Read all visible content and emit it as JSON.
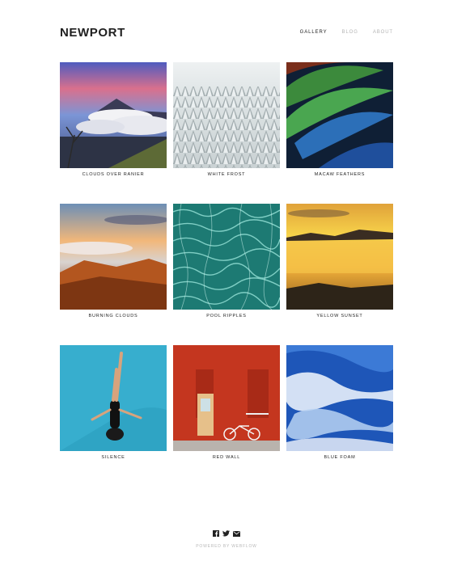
{
  "header": {
    "logo": "NEWPORT",
    "nav": [
      {
        "label": "GALLERY",
        "active": true
      },
      {
        "label": "BLOG",
        "active": false
      },
      {
        "label": "ABOUT",
        "active": false
      }
    ]
  },
  "gallery": [
    {
      "caption": "CLOUDS OVER RANIER"
    },
    {
      "caption": "WHITE FROST"
    },
    {
      "caption": "MACAW FEATHERS"
    },
    {
      "caption": "BURNING CLOUDS"
    },
    {
      "caption": "POOL RIPPLES"
    },
    {
      "caption": "YELLOW SUNSET"
    },
    {
      "caption": "SILENCE"
    },
    {
      "caption": "RED WALL"
    },
    {
      "caption": "BLUE FOAM"
    }
  ],
  "footer": {
    "icons": [
      "facebook-icon",
      "twitter-icon",
      "email-icon"
    ],
    "powered_by": "POWERED BY WEBFLOW"
  },
  "colors": {
    "text": "#222222",
    "muted": "#b5b5b5",
    "background": "#ffffff"
  }
}
